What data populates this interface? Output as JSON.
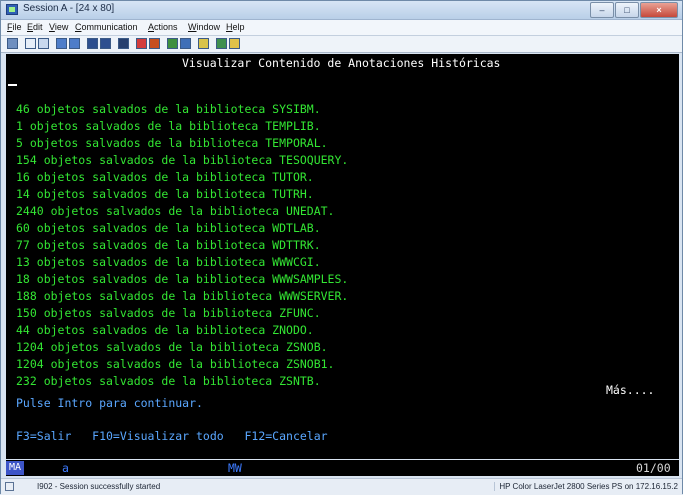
{
  "window": {
    "title": "Session A - [24 x 80]"
  },
  "menu": [
    {
      "label": "File"
    },
    {
      "label": "Edit"
    },
    {
      "label": "View"
    },
    {
      "label": "Communication"
    },
    {
      "label": "Actions"
    },
    {
      "label": "Window"
    },
    {
      "label": "Help"
    }
  ],
  "terminal": {
    "header": "Visualizar Contenido de Anotaciones Históricas",
    "lines": [
      "46 objetos salvados de la biblioteca SYSIBM.",
      "1 objetos salvados de la biblioteca TEMPLIB.",
      "5 objetos salvados de la biblioteca TEMPORAL.",
      "154 objetos salvados de la biblioteca TESOQUERY.",
      "16 objetos salvados de la biblioteca TUTOR.",
      "14 objetos salvados de la biblioteca TUTRH.",
      "2440 objetos salvados de la biblioteca UNEDAT.",
      "60 objetos salvados de la biblioteca WDTLAB.",
      "77 objetos salvados de la biblioteca WDTTRK.",
      "13 objetos salvados de la biblioteca WWWCGI.",
      "18 objetos salvados de la biblioteca WWWSAMPLES.",
      "188 objetos salvados de la biblioteca WWWSERVER.",
      "150 objetos salvados de la biblioteca ZFUNC.",
      "44 objetos salvados de la biblioteca ZNODO.",
      "1204 objetos salvados de la biblioteca ZSNOB.",
      "1204 objetos salvados de la biblioteca ZSNOB1.",
      "232 objetos salvados de la biblioteca ZSNTB."
    ],
    "more": "Más....",
    "prompt": "Pulse Intro para continuar.",
    "fkeys": "F3=Salir   F10=Visualizar todo   F12=Cancelar"
  },
  "oia": {
    "ma": "MA",
    "a": "a",
    "mw": "MW",
    "position": "01/00"
  },
  "status": {
    "number": "I902",
    "message": "I902 - Session successfully started",
    "printer": "HP Color LaserJet 2800 Series PS on 172.16.15.2"
  }
}
